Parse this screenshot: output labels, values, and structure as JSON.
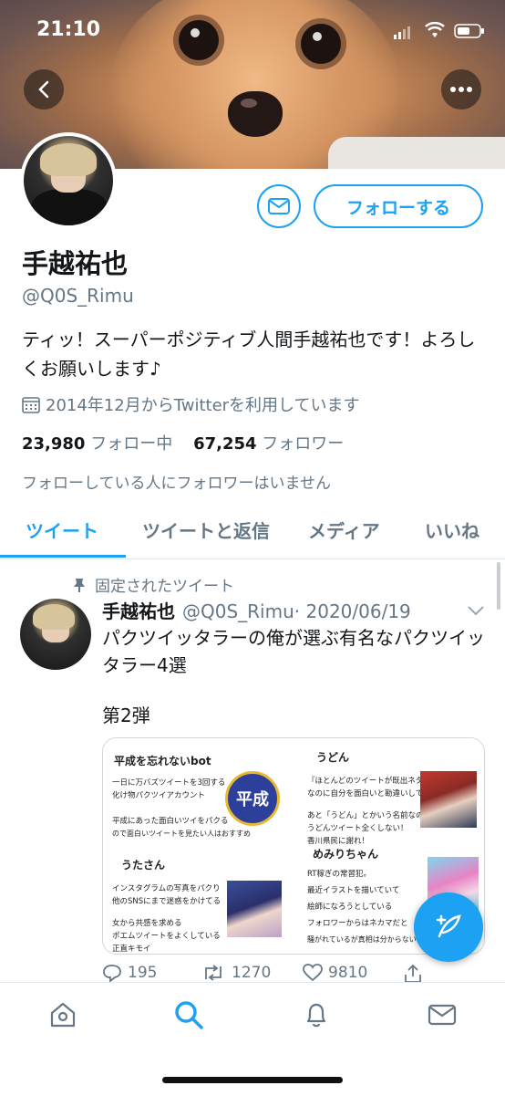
{
  "status_bar": {
    "time": "21:10"
  },
  "profile": {
    "name": "手越祐也",
    "handle": "@Q0S_Rimu",
    "bio": "ティッ！スーパーポジティブ人間手越祐也です！よろしくお願いします♪",
    "joined": "2014年12月からTwitterを利用しています",
    "following_count": "23,980",
    "following_label": "フォロー中",
    "followers_count": "67,254",
    "followers_label": "フォロワー",
    "no_mutual_note": "フォローしている人にフォロワーはいません",
    "follow_button": "フォローする"
  },
  "tabs": [
    {
      "label": "ツイート",
      "active": true
    },
    {
      "label": "ツイートと返信",
      "active": false
    },
    {
      "label": "メディア",
      "active": false
    },
    {
      "label": "いいね",
      "active": false
    }
  ],
  "tweet": {
    "pinned_label": "固定されたツイート",
    "author_name": "手越祐也",
    "author_handle": "@Q0S_Rimu",
    "date": "· 2020/06/19",
    "text": "パクツイッタラーの俺が選ぶ有名なパクツイッタラー4選",
    "text2": "第2弾",
    "media": {
      "cell1": {
        "title": "平成を忘れないbot",
        "lines": [
          "一日に万バズツイートを3回する",
          "化け物パクツイアカウント",
          "平成にあった面白いツイをパクる",
          "ので面白いツイートを見たい人はおすすめ"
        ],
        "badge": "平成"
      },
      "cell2": {
        "title": "うどん",
        "lines": [
          "『ほとんどのツイートが既出ネタ』",
          "なのに自分を面白いと勘違いしてる",
          "あと「うどん」とかいう名前なのに",
          "うどんツイート全くしない！",
          "香川県民に謝れ！"
        ]
      },
      "cell3": {
        "title": "うたさん",
        "lines": [
          "インスタグラムの写真をパクり",
          "他のSNSにまで迷惑をかけてる",
          "女から共感を求める",
          "ポエムツイートをよくしている",
          "正直キモイ"
        ]
      },
      "cell4": {
        "title": "めみりちゃん",
        "lines": [
          "RT稼ぎの常習犯。",
          "最近イラストを描いていて",
          "絵師になろうとしている",
          "フォロワーからはネカマだと",
          "騒がれているが真相は分からない"
        ]
      }
    },
    "replies": "195",
    "retweets": "1270",
    "likes": "9810"
  },
  "colors": {
    "accent": "#1da1f2",
    "secondary_text": "#657786"
  }
}
